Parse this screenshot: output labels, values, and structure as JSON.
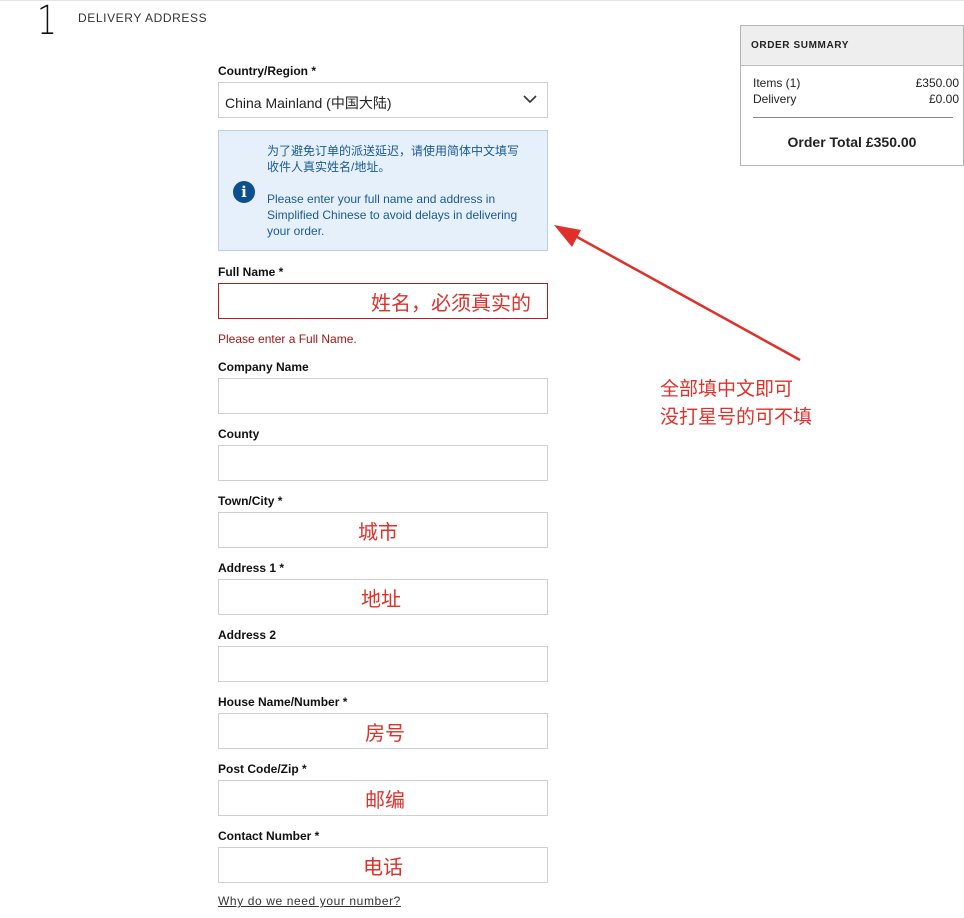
{
  "step": {
    "number": "1",
    "title": "DELIVERY ADDRESS"
  },
  "country": {
    "label": "Country/Region *",
    "value": "China Mainland (中国大陆)"
  },
  "info": {
    "zh": "为了避免订单的派送延迟，请使用简体中文填写收件人真实姓名/地址。",
    "en": "Please enter your full name and address in Simplified Chinese to avoid delays in delivering your order."
  },
  "fields": {
    "full_name": {
      "label": "Full Name *",
      "note": "姓名，必须真实的",
      "error": "Please enter a Full Name."
    },
    "company": {
      "label": "Company Name"
    },
    "county": {
      "label": "County"
    },
    "town": {
      "label": "Town/City *",
      "note": "城市"
    },
    "address1": {
      "label": "Address 1 *",
      "note": "地址"
    },
    "address2": {
      "label": "Address 2"
    },
    "house": {
      "label": "House Name/Number *",
      "note": "房号"
    },
    "postcode": {
      "label": "Post Code/Zip *",
      "note": "邮编"
    },
    "contact": {
      "label": "Contact Number *",
      "note": "电话"
    }
  },
  "why_link": "Why do we need your number?",
  "summary": {
    "title": "ORDER SUMMARY",
    "items_label": "Items (1)",
    "items_amount": "£350.00",
    "delivery_label": "Delivery",
    "delivery_amount": "£0.00",
    "total": "Order Total £350.00"
  },
  "annotation": {
    "line1": "全部填中文即可",
    "line2": "没打星号的可不填"
  },
  "colors": {
    "annotation": "#e0302a",
    "error": "#a31515",
    "info_bg": "#e6f0fa",
    "info_icon": "#0b4f8f"
  },
  "icons": {
    "info": "info-circle-icon",
    "dropdown": "chevron-down-icon"
  }
}
